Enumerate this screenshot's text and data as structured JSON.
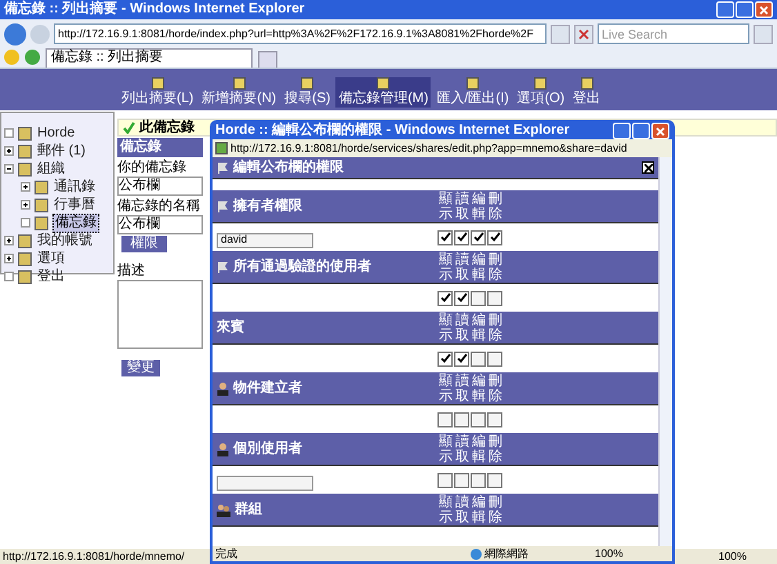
{
  "browser": {
    "title": "備忘錄 :: 列出摘要 - Windows Internet Explorer",
    "address": "http://172.16.9.1:8081/horde/index.php?url=http%3A%2F%2F172.16.9.1%3A8081%2Fhorde%2F",
    "search_placeholder": "Live Search",
    "tab": "備忘錄 :: 列出摘要",
    "status_url": "http://172.16.9.1:8081/horde/mnemo/",
    "zoom": "100%"
  },
  "toolbar": [
    {
      "label": "列出摘要(L)",
      "selected": false
    },
    {
      "label": "新增摘要(N)",
      "selected": false
    },
    {
      "label": "搜尋(S)",
      "selected": false
    },
    {
      "label": "備忘錄管理(M)",
      "selected": true
    },
    {
      "label": "匯入/匯出(I)",
      "selected": false
    },
    {
      "label": "選項(O)",
      "selected": false
    },
    {
      "label": "登出",
      "selected": false
    }
  ],
  "sidebar": {
    "items": [
      {
        "label": "Horde",
        "selected": false
      },
      {
        "label": "郵件 (1)",
        "selected": false,
        "expanded": false
      },
      {
        "label": "組織",
        "selected": false,
        "expanded": true,
        "children": [
          {
            "label": "通訊錄",
            "selected": false,
            "expanded": false
          },
          {
            "label": "行事曆",
            "selected": false,
            "expanded": false
          },
          {
            "label": "備忘錄",
            "selected": true
          }
        ]
      },
      {
        "label": "我的帳號",
        "selected": false,
        "expanded": false
      },
      {
        "label": "選項",
        "selected": false,
        "expanded": false
      },
      {
        "label": "登出",
        "selected": false
      }
    ]
  },
  "notice": "此備忘錄",
  "panel": {
    "title": "備忘錄",
    "fields": [
      {
        "label": "你的備忘錄",
        "value": "公布欄"
      },
      {
        "label": "備忘錄的名稱",
        "value": "公布欄"
      }
    ],
    "permissions_button": "權限",
    "description_label": "描述",
    "save_button": "變更"
  },
  "popup": {
    "title": "Horde :: 編輯公布欄的權限 - Windows Internet Explorer",
    "address": "http://172.16.9.1:8081/horde/services/shares/edit.php?app=mnemo&share=david",
    "heading": "編輯公布欄的權限",
    "status": "完成",
    "zone": "網際網路",
    "zoom": "100%",
    "sections": [
      {
        "title": "擁有者權限",
        "kind": "flag",
        "columns": [
          "顯示",
          "讀取",
          "編輯",
          "刪除"
        ],
        "has_input": true,
        "value": "david",
        "checks": [
          true,
          true,
          true,
          true
        ]
      },
      {
        "title": "所有通過驗證的使用者",
        "kind": "flag",
        "columns": [
          "顯示",
          "讀取",
          "編輯",
          "刪除"
        ],
        "has_input": false,
        "checks": [
          true,
          true,
          false,
          false
        ]
      },
      {
        "title": "來賓",
        "kind": "plain",
        "columns": [
          "顯示",
          "讀取",
          "編輯",
          "刪除"
        ],
        "has_input": false,
        "checks": [
          true,
          true,
          false,
          false
        ]
      },
      {
        "title": "物件建立者",
        "kind": "person",
        "columns": [
          "顯示",
          "讀取",
          "編輯",
          "刪除"
        ],
        "has_input": false,
        "checks": [
          false,
          false,
          false,
          false
        ]
      },
      {
        "title": "個別使用者",
        "kind": "person",
        "columns": [
          "顯示",
          "讀取",
          "編輯",
          "刪除"
        ],
        "has_input": true,
        "checks": [
          false,
          false,
          false,
          false
        ]
      },
      {
        "title": "群組",
        "kind": "group",
        "columns": [
          "顯示",
          "讀取",
          "編輯",
          "刪除"
        ]
      }
    ]
  }
}
